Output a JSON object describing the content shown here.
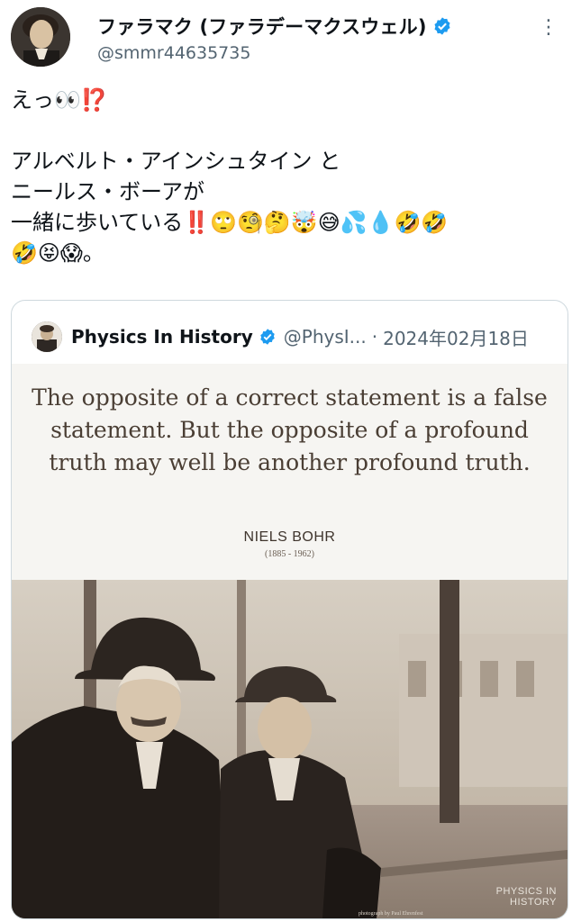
{
  "tweet": {
    "display_name": "ファラマク (ファラデーマクスウェル)",
    "handle": "@smmr44635735",
    "more_label": "⋮",
    "text": "えっ👀⁉️\n\nアルベルト・アインシュタイン と\nニールス・ボーアが\n一緒に歩いている‼️🙄🧐🤔🤯😅💦💧🤣🤣\n🤣😝😱。"
  },
  "quoted": {
    "name": "Physics In History",
    "handle": "@PhysI...",
    "separator": "·",
    "date": "2024年02月18日",
    "image": {
      "quote": "The opposite of a correct statement is a false statement. But the opposite of a profound truth may well be another profound truth.",
      "author": "NIELS BOHR",
      "years": "(1885 - 1962)",
      "brand_line1": "PHYSICS IN",
      "brand_line2": "HISTORY",
      "credit": "photograph by Paul Ehrenfest"
    }
  },
  "colors": {
    "verified": "#1d9bf0",
    "secondary_text": "#536471",
    "border": "#cfd9de"
  }
}
